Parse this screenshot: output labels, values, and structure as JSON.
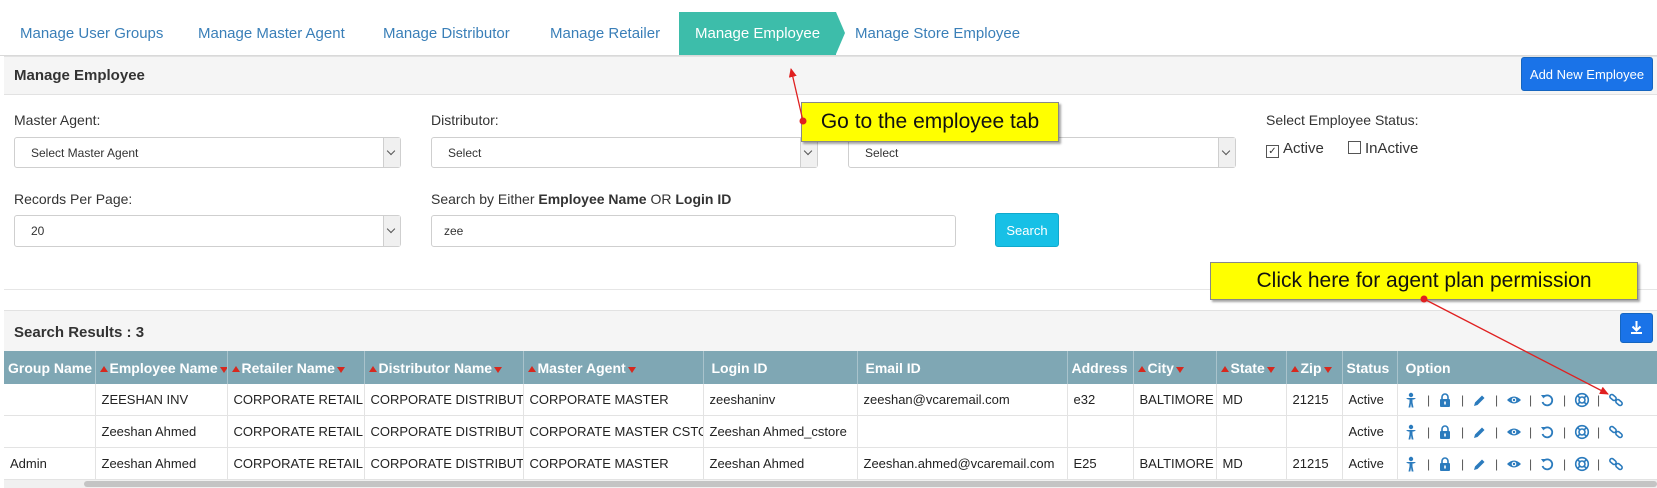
{
  "tabs": [
    {
      "label": "Manage User Groups"
    },
    {
      "label": "Manage Master Agent"
    },
    {
      "label": "Manage Distributor"
    },
    {
      "label": "Manage Retailer"
    },
    {
      "label": "Manage Employee"
    },
    {
      "label": "Manage Store Employee"
    }
  ],
  "panel": {
    "title": "Manage Employee",
    "add_button": "Add New Employee"
  },
  "filters": {
    "master_agent_label": "Master Agent:",
    "master_agent_value": "Select Master Agent",
    "distributor_label": "Distributor:",
    "distributor_value": "Select",
    "retailer_value": "Select",
    "status_label": "Select Employee Status:",
    "status_active": "Active",
    "status_inactive": "InActive",
    "records_label": "Records Per Page:",
    "records_value": "20",
    "search_label_pre": "Search by Either ",
    "search_label_name": "Employee Name",
    "search_label_or": " OR ",
    "search_label_login": "Login ID",
    "search_value": "zee",
    "search_button": "Search"
  },
  "results": {
    "title": "Search Results : 3",
    "columns": [
      "Group Name",
      "Employee Name",
      "Retailer Name",
      "Distributor Name",
      "Master Agent",
      "Login ID",
      "Email ID",
      "Address",
      "City",
      "State",
      "Zip",
      "Status",
      "Option"
    ],
    "rows": [
      [
        "",
        "ZEESHAN INV",
        "CORPORATE RETAILER",
        "CORPORATE DISTRIBUTER",
        "CORPORATE MASTER",
        "zeeshaninv",
        "zeeshan@vcaremail.com",
        "e32",
        "BALTIMORE",
        "MD",
        "21215",
        "Active"
      ],
      [
        "",
        "Zeeshan Ahmed",
        "CORPORATE RETAILER",
        "CORPORATE DISTRIBUTER",
        "CORPORATE MASTER CSTORE",
        "Zeeshan Ahmed_cstore",
        "",
        "",
        "",
        "",
        "",
        "Active"
      ],
      [
        "Admin",
        "Zeeshan Ahmed",
        "CORPORATE RETAILER",
        "CORPORATE DISTRIBUTER",
        "CORPORATE MASTER",
        "Zeeshan Ahmed",
        "Zeeshan.ahmed@vcaremail.com",
        "E25",
        "BALTIMORE",
        "MD",
        "21215",
        "Active"
      ]
    ]
  },
  "callouts": {
    "employee_tab": "Go to the employee tab",
    "agent_plan": "Click here for agent plan permission"
  },
  "colors": {
    "active_tab": "#3dbdaa",
    "table_header": "#7fa7b4",
    "primary_button": "#1a73e8",
    "search_button": "#17c0e6",
    "callout": "#ffff00",
    "arrow": "#e02020",
    "icon": "#2b7bbd"
  }
}
